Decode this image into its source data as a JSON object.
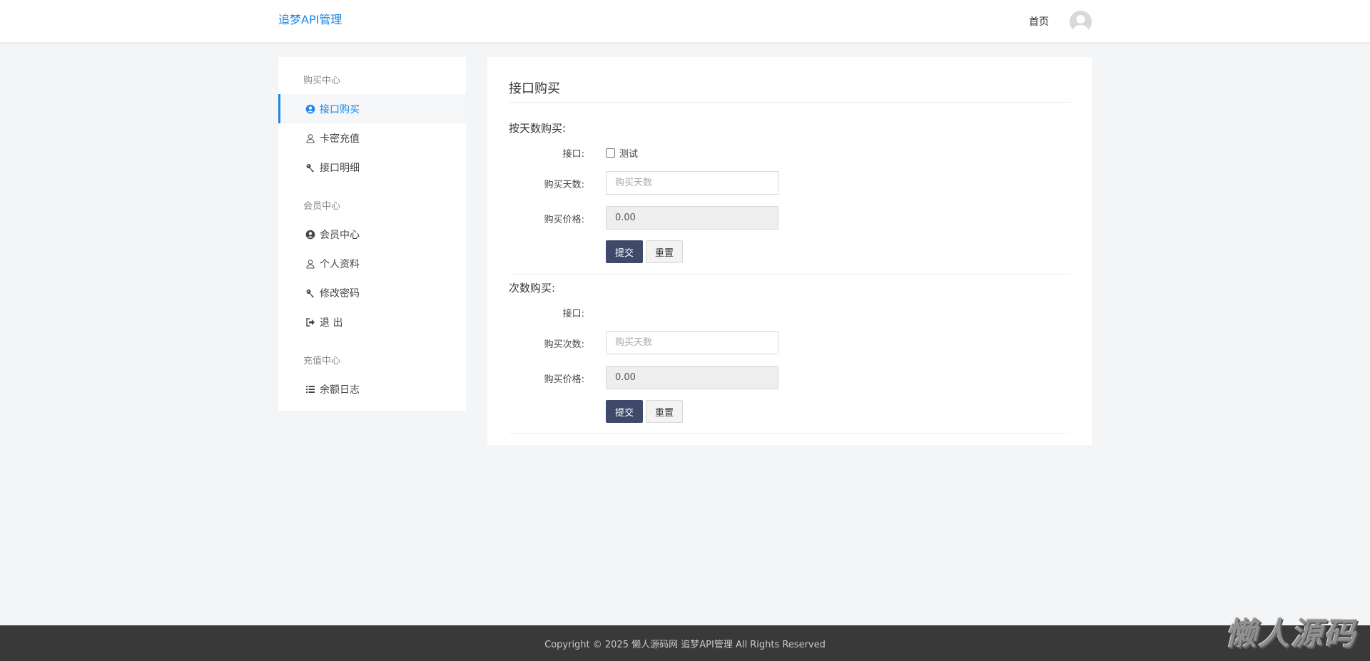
{
  "header": {
    "brand": "追梦API管理",
    "nav_home": "首页"
  },
  "sidebar": {
    "groups": [
      {
        "title": "购买中心",
        "items": [
          {
            "label": "接口购买",
            "icon": "user-circle-icon",
            "active": true
          },
          {
            "label": "卡密充值",
            "icon": "user-icon",
            "active": false
          },
          {
            "label": "接口明细",
            "icon": "key-icon",
            "active": false
          }
        ]
      },
      {
        "title": "会员中心",
        "items": [
          {
            "label": "会员中心",
            "icon": "user-circle-icon",
            "active": false
          },
          {
            "label": "个人资料",
            "icon": "user-icon",
            "active": false
          },
          {
            "label": "修改密码",
            "icon": "key-icon",
            "active": false
          },
          {
            "label": "退 出",
            "icon": "sign-out-icon",
            "active": false
          }
        ]
      },
      {
        "title": "充值中心",
        "items": [
          {
            "label": "余额日志",
            "icon": "list-icon",
            "active": false
          }
        ]
      }
    ]
  },
  "main": {
    "title": "接口购买",
    "by_days": {
      "section_title": "按天数购买:",
      "api_label": "接口:",
      "api_option": "测试",
      "days_label": "购买天数:",
      "days_placeholder": "购买天数",
      "price_label": "购买价格:",
      "price_value": "0.00",
      "submit": "提交",
      "reset": "重置"
    },
    "by_count": {
      "section_title": "次数购买:",
      "api_label": "接口:",
      "count_label": "购买次数:",
      "count_placeholder": "购买天数",
      "price_label": "购买价格:",
      "price_value": "0.00",
      "submit": "提交",
      "reset": "重置"
    }
  },
  "footer": {
    "copyright": "Copyright © 2025 懒人源码网 追梦API管理 All Rights Reserved"
  },
  "watermark": "懒人源码",
  "colors": {
    "accent": "#1e88e5",
    "primary_button": "#3f4a6b",
    "footer_bg": "#393939",
    "page_bg": "#f4f5f7"
  }
}
